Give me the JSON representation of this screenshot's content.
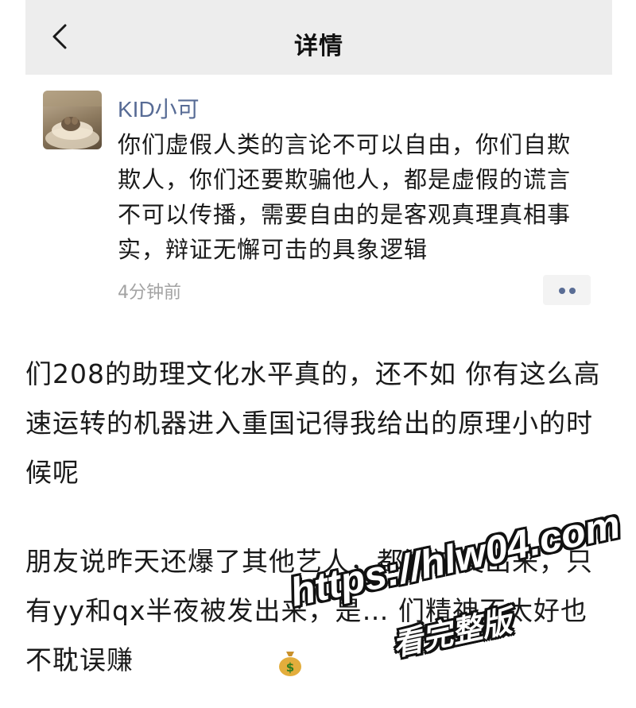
{
  "header": {
    "title": "详情",
    "back_icon": "chevron-left-icon"
  },
  "comment": {
    "username": "KID小可",
    "text": "你们虚假人类的言论不可以自由，你们自欺欺人，你们还要欺骗他人，都是虚假的谎言不可以传播，需要自由的是客观真理真相事实，辩证无懈可击的具象逻辑",
    "timestamp": "4分钟前",
    "more_icon": "more-dots-icon",
    "username_color": "#576b95"
  },
  "body": {
    "paragraph1": "们208的助理文化水平真的，还不如 你有这么高速运转的机器进入重国记得我给出的原理小的时候呢",
    "paragraph2": "朋友说昨天还爆了其他艺人，都没被发出来，只有yy和qx半夜被发出来，是… 们精神不太好也不耽误赚",
    "emoji_icon": "money-bag-icon"
  },
  "watermark": {
    "url": "https://hlw04.com",
    "sub": "看完整版"
  }
}
